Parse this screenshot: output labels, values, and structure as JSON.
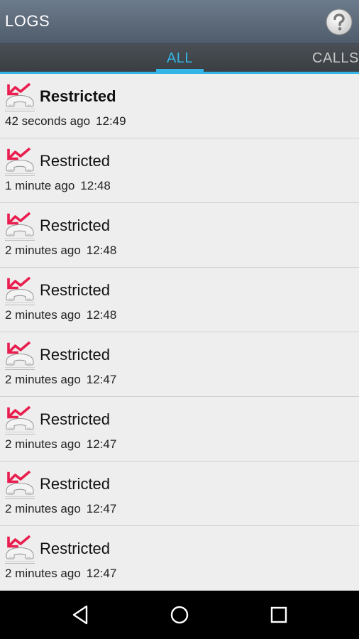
{
  "app_bar": {
    "title": "LOGS",
    "help_icon": "help-question-icon"
  },
  "tabs": [
    {
      "label": "ALL",
      "selected": true
    },
    {
      "label": "CALLS",
      "selected": false
    }
  ],
  "colors": {
    "accent": "#33b5e5",
    "missed_call": "#e91e4f",
    "app_bar": "#5d6a79"
  },
  "logs": [
    {
      "name": "Restricted",
      "ago": "42 seconds ago",
      "time": "12:49",
      "icon": "missed-call-icon"
    },
    {
      "name": "Restricted",
      "ago": "1 minute ago",
      "time": "12:48",
      "icon": "missed-call-icon"
    },
    {
      "name": "Restricted",
      "ago": "2 minutes ago",
      "time": "12:48",
      "icon": "missed-call-icon"
    },
    {
      "name": "Restricted",
      "ago": "2 minutes ago",
      "time": "12:48",
      "icon": "missed-call-icon"
    },
    {
      "name": "Restricted",
      "ago": "2 minutes ago",
      "time": "12:47",
      "icon": "missed-call-icon"
    },
    {
      "name": "Restricted",
      "ago": "2 minutes ago",
      "time": "12:47",
      "icon": "missed-call-icon"
    },
    {
      "name": "Restricted",
      "ago": "2 minutes ago",
      "time": "12:47",
      "icon": "missed-call-icon"
    },
    {
      "name": "Restricted",
      "ago": "2 minutes ago",
      "time": "12:47",
      "icon": "missed-call-icon"
    }
  ],
  "nav_bar": {
    "back_icon": "back-icon",
    "home_icon": "home-icon",
    "recents_icon": "recents-icon"
  }
}
